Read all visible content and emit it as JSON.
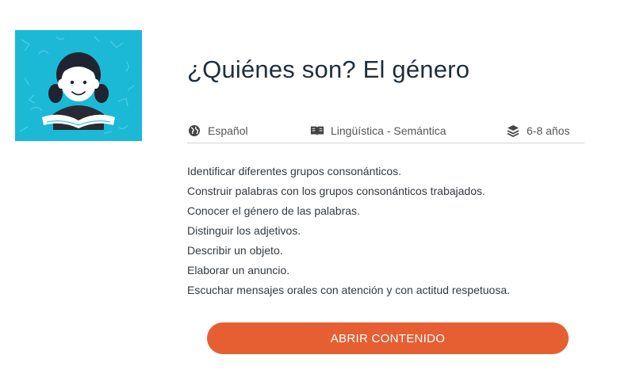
{
  "title": "¿Quiénes son? El género",
  "meta": {
    "language": "Español",
    "area": "Lingüística - Semántica",
    "age": "6-8 años"
  },
  "objectives": [
    "Identificar diferentes grupos consonánticos.",
    "Construir palabras con los grupos consonánticos trabajados.",
    "Conocer el género de las palabras.",
    "Distinguir los adjetivos.",
    "Describir un objeto.",
    "Elaborar un anuncio.",
    "Escuchar mensajes orales con atención y con actitud respetuosa."
  ],
  "button": {
    "label": "ABRIR CONTENIDO"
  },
  "icons": {
    "language": "globe-icon",
    "area": "book-icon",
    "age": "layers-icon"
  },
  "colors": {
    "thumbnail_bg": "#1bb9d6",
    "button_bg": "#e55f32",
    "title": "#1e2f3d"
  }
}
